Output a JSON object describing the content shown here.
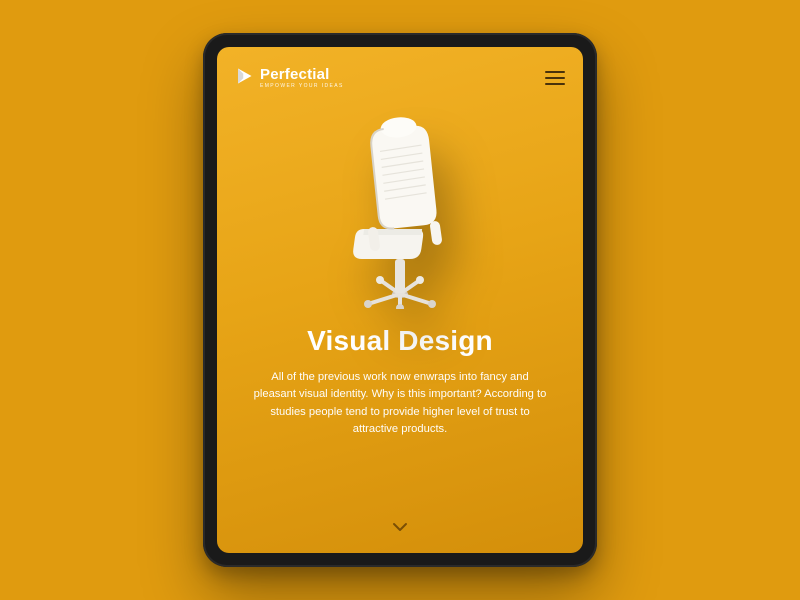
{
  "brand": {
    "name": "Perfectial",
    "tagline": "EMPOWER YOUR IDEAS"
  },
  "page": {
    "title": "Visual Design",
    "description": "All of the previous work now enwraps into fancy and pleasant visual identity. Why is this important? According to studies people tend to provide higher level of trust to attractive products."
  },
  "colors": {
    "background": "#e09b0f",
    "screen_accent": "#f2b227",
    "text": "#ffffff"
  },
  "hero": {
    "object": "office-chair",
    "color": "white"
  }
}
